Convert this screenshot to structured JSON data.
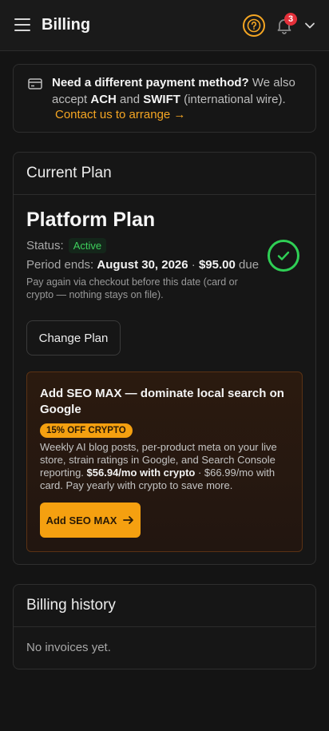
{
  "header": {
    "title": "Billing",
    "notification_count": "3",
    "accent": "#f5a623",
    "badge_color": "#e3303a"
  },
  "info": {
    "heading": "Need a different payment method?",
    "text_1": " We also accept ",
    "ach": "ACH",
    "text_2": " and ",
    "swift": "SWIFT",
    "text_3": " (international wire).",
    "link": "Contact us to arrange →"
  },
  "plan": {
    "section_title": "Current Plan",
    "name": "Platform Plan",
    "status_label": "Status:",
    "status": "Active",
    "period_label": "Period ends:",
    "period_date": "August 30, 2026",
    "separator": " · ",
    "amount": "$95.00",
    "due": " due",
    "note": "Pay again via checkout before this date (card or crypto — nothing stays on file).",
    "change_button": "Change Plan",
    "status_color": "#2fcf55"
  },
  "promo": {
    "title": "Add SEO MAX — dominate local search on Google",
    "discount": "15% OFF CRYPTO",
    "body_1": "Weekly AI blog posts, per-product meta on your live store, strain ratings in Google, and Search Console reporting. ",
    "crypto_price": "$56.94/mo with crypto",
    "body_2": " · $66.99/mo with card. Pay yearly with crypto to save more.",
    "button": "Add SEO MAX",
    "button_color": "#f5a010"
  },
  "history": {
    "section_title": "Billing history",
    "empty": "No invoices yet."
  }
}
